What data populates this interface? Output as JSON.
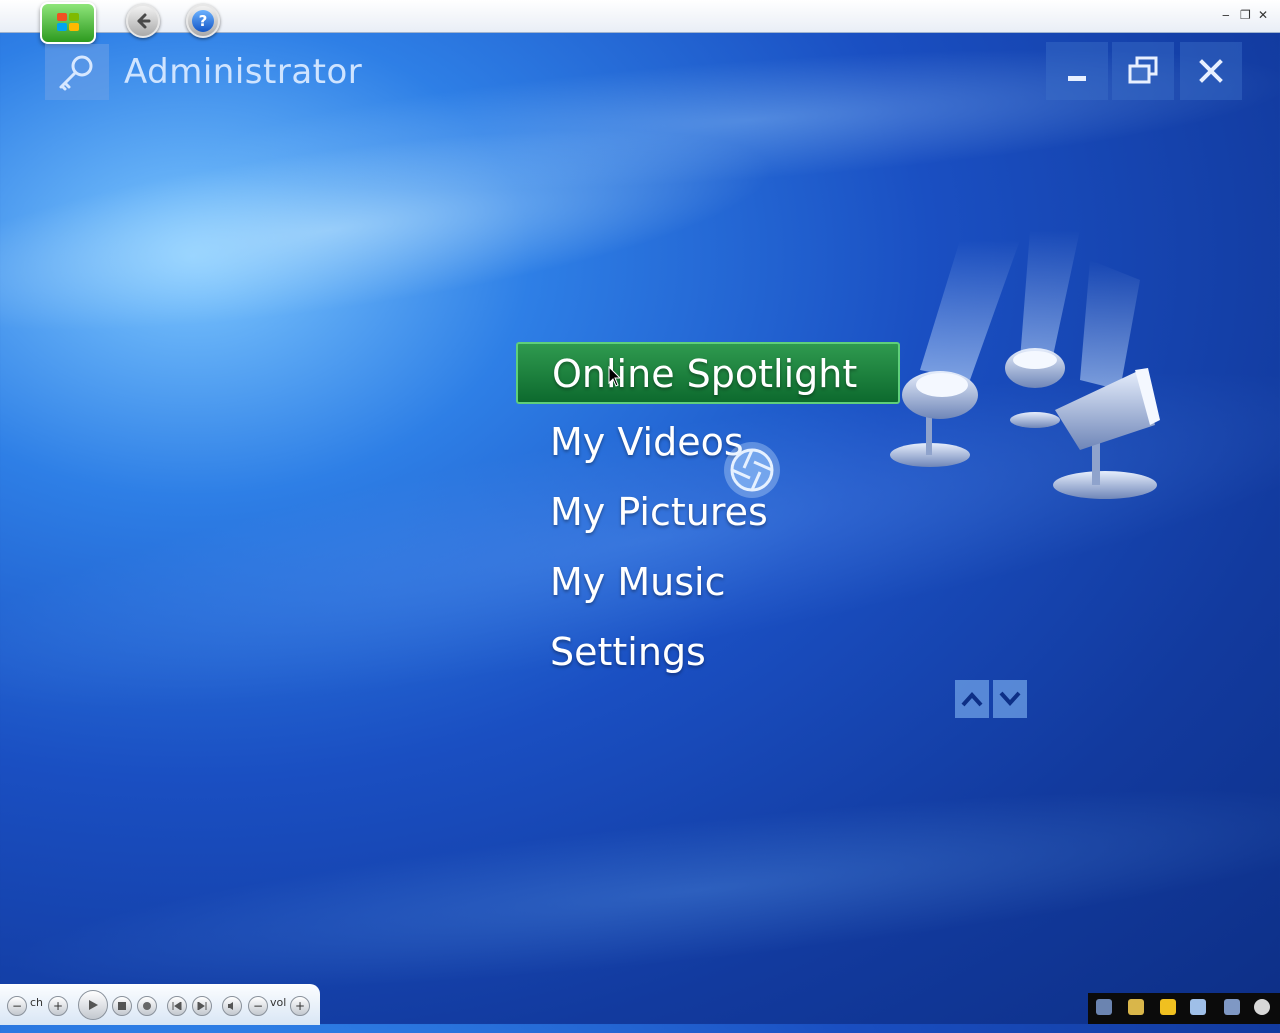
{
  "header": {
    "user_name": "Administrator"
  },
  "title_bar": {
    "minimize_glyph": "‒",
    "restore_glyph": "❐",
    "close_glyph": "✕",
    "help_glyph": "?"
  },
  "window_controls": {
    "close_glyph": "✕"
  },
  "menu": {
    "items": [
      {
        "label": "Online Spotlight",
        "focused": true
      },
      {
        "label": "My Videos",
        "focused": false
      },
      {
        "label": "My Pictures",
        "focused": false
      },
      {
        "label": "My Music",
        "focused": false
      },
      {
        "label": "Settings",
        "focused": false
      }
    ]
  },
  "transport": {
    "ch_label": "ch",
    "vol_label": "vol",
    "minus_glyph": "−",
    "plus_glyph": "+"
  },
  "colors": {
    "focus_green": "#1f8a43",
    "background_blue": "#1a4fc2",
    "text_light_blue": "#cfe4ff"
  },
  "icons": [
    "windows-logo-icon",
    "back-arrow-icon",
    "help-icon",
    "key-icon",
    "minimize-icon",
    "restore-icon",
    "close-icon",
    "spotlight-lamp-icon",
    "busy-spinner-icon",
    "scroll-up-icon",
    "scroll-down-icon"
  ]
}
